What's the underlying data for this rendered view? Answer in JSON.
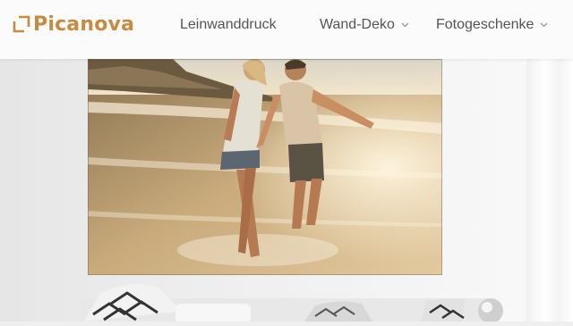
{
  "brand": {
    "name": "Picanova",
    "logo_color": "#c68b3f"
  },
  "nav": {
    "items": [
      {
        "label": "Leinwanddruck",
        "has_dropdown": false
      },
      {
        "label": "Wand-Deko",
        "has_dropdown": true
      },
      {
        "label": "Fotogeschenke",
        "has_dropdown": true
      }
    ]
  },
  "hero": {
    "image": "couple-walking-on-beach-canvas-print",
    "setting": "living-room-wall-with-sofa"
  },
  "colors": {
    "nav_text": "#555555",
    "header_bg": "#fbfbfb",
    "accent": "#c68b3f"
  },
  "icons": {
    "dropdown": "chevron-down-icon"
  }
}
